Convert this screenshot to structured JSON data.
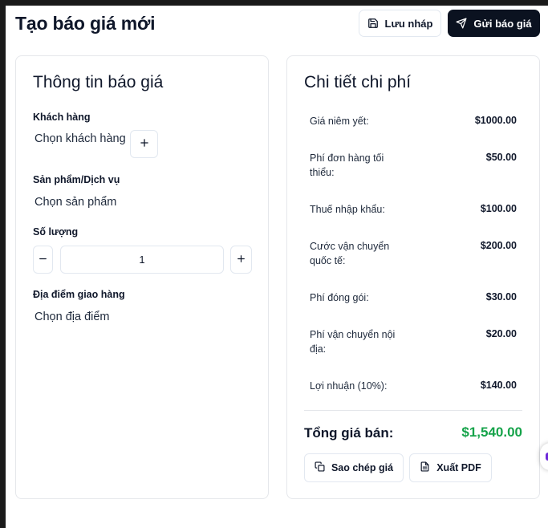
{
  "header": {
    "title": "Tạo báo giá mới",
    "draft_label": "Lưu nháp",
    "send_label": "Gửi báo giá"
  },
  "info_card": {
    "title": "Thông tin báo giá",
    "customer_label": "Khách hàng",
    "customer_value": "Chọn khách hàng",
    "product_label": "Sản phẩm/Dịch vụ",
    "product_value": "Chọn sản phẩm",
    "quantity_label": "Số lượng",
    "quantity_value": "1",
    "location_label": "Địa điểm giao hàng",
    "location_value": "Chọn địa điểm"
  },
  "cost_card": {
    "title": "Chi tiết chi phí",
    "items": [
      {
        "label": "Giá niêm yết:",
        "value": "$1000.00"
      },
      {
        "label": "Phí đơn hàng tối thiểu:",
        "value": "$50.00"
      },
      {
        "label": "Thuế nhập khẩu:",
        "value": "$100.00"
      },
      {
        "label": "Cước vận chuyển quốc tế:",
        "value": "$200.00"
      },
      {
        "label": "Phí đóng gói:",
        "value": "$30.00"
      },
      {
        "label": "Phí vận chuyển nội địa:",
        "value": "$20.00"
      },
      {
        "label": "Lợi nhuận (10%):",
        "value": "$140.00"
      }
    ],
    "total_label": "Tổng giá bán:",
    "total_value": "$1,540.00",
    "copy_label": "Sao chép giá",
    "pdf_label": "Xuất PDF"
  },
  "icons": {
    "draft": "save-icon",
    "send": "send-icon",
    "add": "plus-icon",
    "decrement": "minus-icon",
    "increment": "plus-icon",
    "copy": "copy-icon",
    "pdf": "file-text-icon"
  },
  "colors": {
    "primary": "#0b1220",
    "total": "#16a34a",
    "border": "#e2e8f0"
  }
}
